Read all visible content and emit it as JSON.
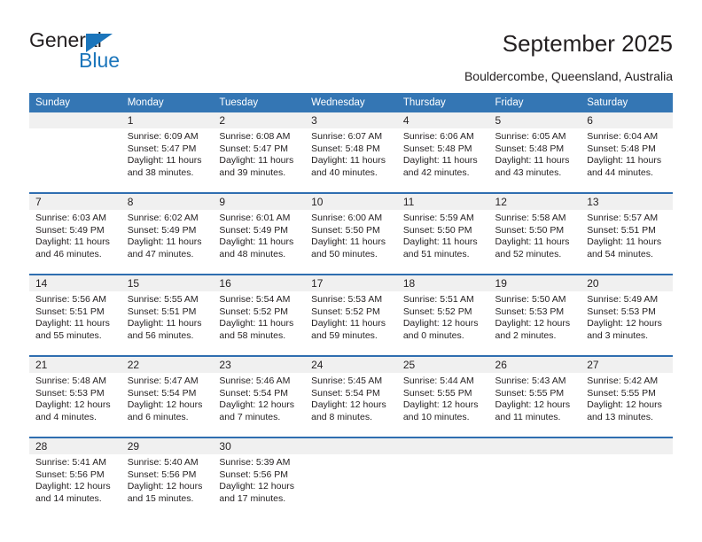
{
  "brand": {
    "name_top": "General",
    "name_bottom": "Blue",
    "triangle_color": "#1b75bb",
    "text_color_top": "#231f20",
    "text_color_bottom": "#1b75bb"
  },
  "header": {
    "title": "September 2025",
    "subtitle": "Bouldercombe, Queensland, Australia"
  },
  "theme": {
    "header_blue": "#3476b4",
    "rule_blue": "#2f6eb0",
    "daynum_band": "#f0f0f0",
    "text": "#231f20"
  },
  "weekday_headers": [
    "Sunday",
    "Monday",
    "Tuesday",
    "Wednesday",
    "Thursday",
    "Friday",
    "Saturday"
  ],
  "weeks": [
    [
      {
        "empty": true
      },
      {
        "day": "1",
        "sunrise": "Sunrise: 6:09 AM",
        "sunset": "Sunset: 5:47 PM",
        "daylight": "Daylight: 11 hours and 38 minutes."
      },
      {
        "day": "2",
        "sunrise": "Sunrise: 6:08 AM",
        "sunset": "Sunset: 5:47 PM",
        "daylight": "Daylight: 11 hours and 39 minutes."
      },
      {
        "day": "3",
        "sunrise": "Sunrise: 6:07 AM",
        "sunset": "Sunset: 5:48 PM",
        "daylight": "Daylight: 11 hours and 40 minutes."
      },
      {
        "day": "4",
        "sunrise": "Sunrise: 6:06 AM",
        "sunset": "Sunset: 5:48 PM",
        "daylight": "Daylight: 11 hours and 42 minutes."
      },
      {
        "day": "5",
        "sunrise": "Sunrise: 6:05 AM",
        "sunset": "Sunset: 5:48 PM",
        "daylight": "Daylight: 11 hours and 43 minutes."
      },
      {
        "day": "6",
        "sunrise": "Sunrise: 6:04 AM",
        "sunset": "Sunset: 5:48 PM",
        "daylight": "Daylight: 11 hours and 44 minutes."
      }
    ],
    [
      {
        "day": "7",
        "sunrise": "Sunrise: 6:03 AM",
        "sunset": "Sunset: 5:49 PM",
        "daylight": "Daylight: 11 hours and 46 minutes."
      },
      {
        "day": "8",
        "sunrise": "Sunrise: 6:02 AM",
        "sunset": "Sunset: 5:49 PM",
        "daylight": "Daylight: 11 hours and 47 minutes."
      },
      {
        "day": "9",
        "sunrise": "Sunrise: 6:01 AM",
        "sunset": "Sunset: 5:49 PM",
        "daylight": "Daylight: 11 hours and 48 minutes."
      },
      {
        "day": "10",
        "sunrise": "Sunrise: 6:00 AM",
        "sunset": "Sunset: 5:50 PM",
        "daylight": "Daylight: 11 hours and 50 minutes."
      },
      {
        "day": "11",
        "sunrise": "Sunrise: 5:59 AM",
        "sunset": "Sunset: 5:50 PM",
        "daylight": "Daylight: 11 hours and 51 minutes."
      },
      {
        "day": "12",
        "sunrise": "Sunrise: 5:58 AM",
        "sunset": "Sunset: 5:50 PM",
        "daylight": "Daylight: 11 hours and 52 minutes."
      },
      {
        "day": "13",
        "sunrise": "Sunrise: 5:57 AM",
        "sunset": "Sunset: 5:51 PM",
        "daylight": "Daylight: 11 hours and 54 minutes."
      }
    ],
    [
      {
        "day": "14",
        "sunrise": "Sunrise: 5:56 AM",
        "sunset": "Sunset: 5:51 PM",
        "daylight": "Daylight: 11 hours and 55 minutes."
      },
      {
        "day": "15",
        "sunrise": "Sunrise: 5:55 AM",
        "sunset": "Sunset: 5:51 PM",
        "daylight": "Daylight: 11 hours and 56 minutes."
      },
      {
        "day": "16",
        "sunrise": "Sunrise: 5:54 AM",
        "sunset": "Sunset: 5:52 PM",
        "daylight": "Daylight: 11 hours and 58 minutes."
      },
      {
        "day": "17",
        "sunrise": "Sunrise: 5:53 AM",
        "sunset": "Sunset: 5:52 PM",
        "daylight": "Daylight: 11 hours and 59 minutes."
      },
      {
        "day": "18",
        "sunrise": "Sunrise: 5:51 AM",
        "sunset": "Sunset: 5:52 PM",
        "daylight": "Daylight: 12 hours and 0 minutes."
      },
      {
        "day": "19",
        "sunrise": "Sunrise: 5:50 AM",
        "sunset": "Sunset: 5:53 PM",
        "daylight": "Daylight: 12 hours and 2 minutes."
      },
      {
        "day": "20",
        "sunrise": "Sunrise: 5:49 AM",
        "sunset": "Sunset: 5:53 PM",
        "daylight": "Daylight: 12 hours and 3 minutes."
      }
    ],
    [
      {
        "day": "21",
        "sunrise": "Sunrise: 5:48 AM",
        "sunset": "Sunset: 5:53 PM",
        "daylight": "Daylight: 12 hours and 4 minutes."
      },
      {
        "day": "22",
        "sunrise": "Sunrise: 5:47 AM",
        "sunset": "Sunset: 5:54 PM",
        "daylight": "Daylight: 12 hours and 6 minutes."
      },
      {
        "day": "23",
        "sunrise": "Sunrise: 5:46 AM",
        "sunset": "Sunset: 5:54 PM",
        "daylight": "Daylight: 12 hours and 7 minutes."
      },
      {
        "day": "24",
        "sunrise": "Sunrise: 5:45 AM",
        "sunset": "Sunset: 5:54 PM",
        "daylight": "Daylight: 12 hours and 8 minutes."
      },
      {
        "day": "25",
        "sunrise": "Sunrise: 5:44 AM",
        "sunset": "Sunset: 5:55 PM",
        "daylight": "Daylight: 12 hours and 10 minutes."
      },
      {
        "day": "26",
        "sunrise": "Sunrise: 5:43 AM",
        "sunset": "Sunset: 5:55 PM",
        "daylight": "Daylight: 12 hours and 11 minutes."
      },
      {
        "day": "27",
        "sunrise": "Sunrise: 5:42 AM",
        "sunset": "Sunset: 5:55 PM",
        "daylight": "Daylight: 12 hours and 13 minutes."
      }
    ],
    [
      {
        "day": "28",
        "sunrise": "Sunrise: 5:41 AM",
        "sunset": "Sunset: 5:56 PM",
        "daylight": "Daylight: 12 hours and 14 minutes."
      },
      {
        "day": "29",
        "sunrise": "Sunrise: 5:40 AM",
        "sunset": "Sunset: 5:56 PM",
        "daylight": "Daylight: 12 hours and 15 minutes."
      },
      {
        "day": "30",
        "sunrise": "Sunrise: 5:39 AM",
        "sunset": "Sunset: 5:56 PM",
        "daylight": "Daylight: 12 hours and 17 minutes."
      },
      {
        "empty": true
      },
      {
        "empty": true
      },
      {
        "empty": true
      },
      {
        "empty": true
      }
    ]
  ]
}
